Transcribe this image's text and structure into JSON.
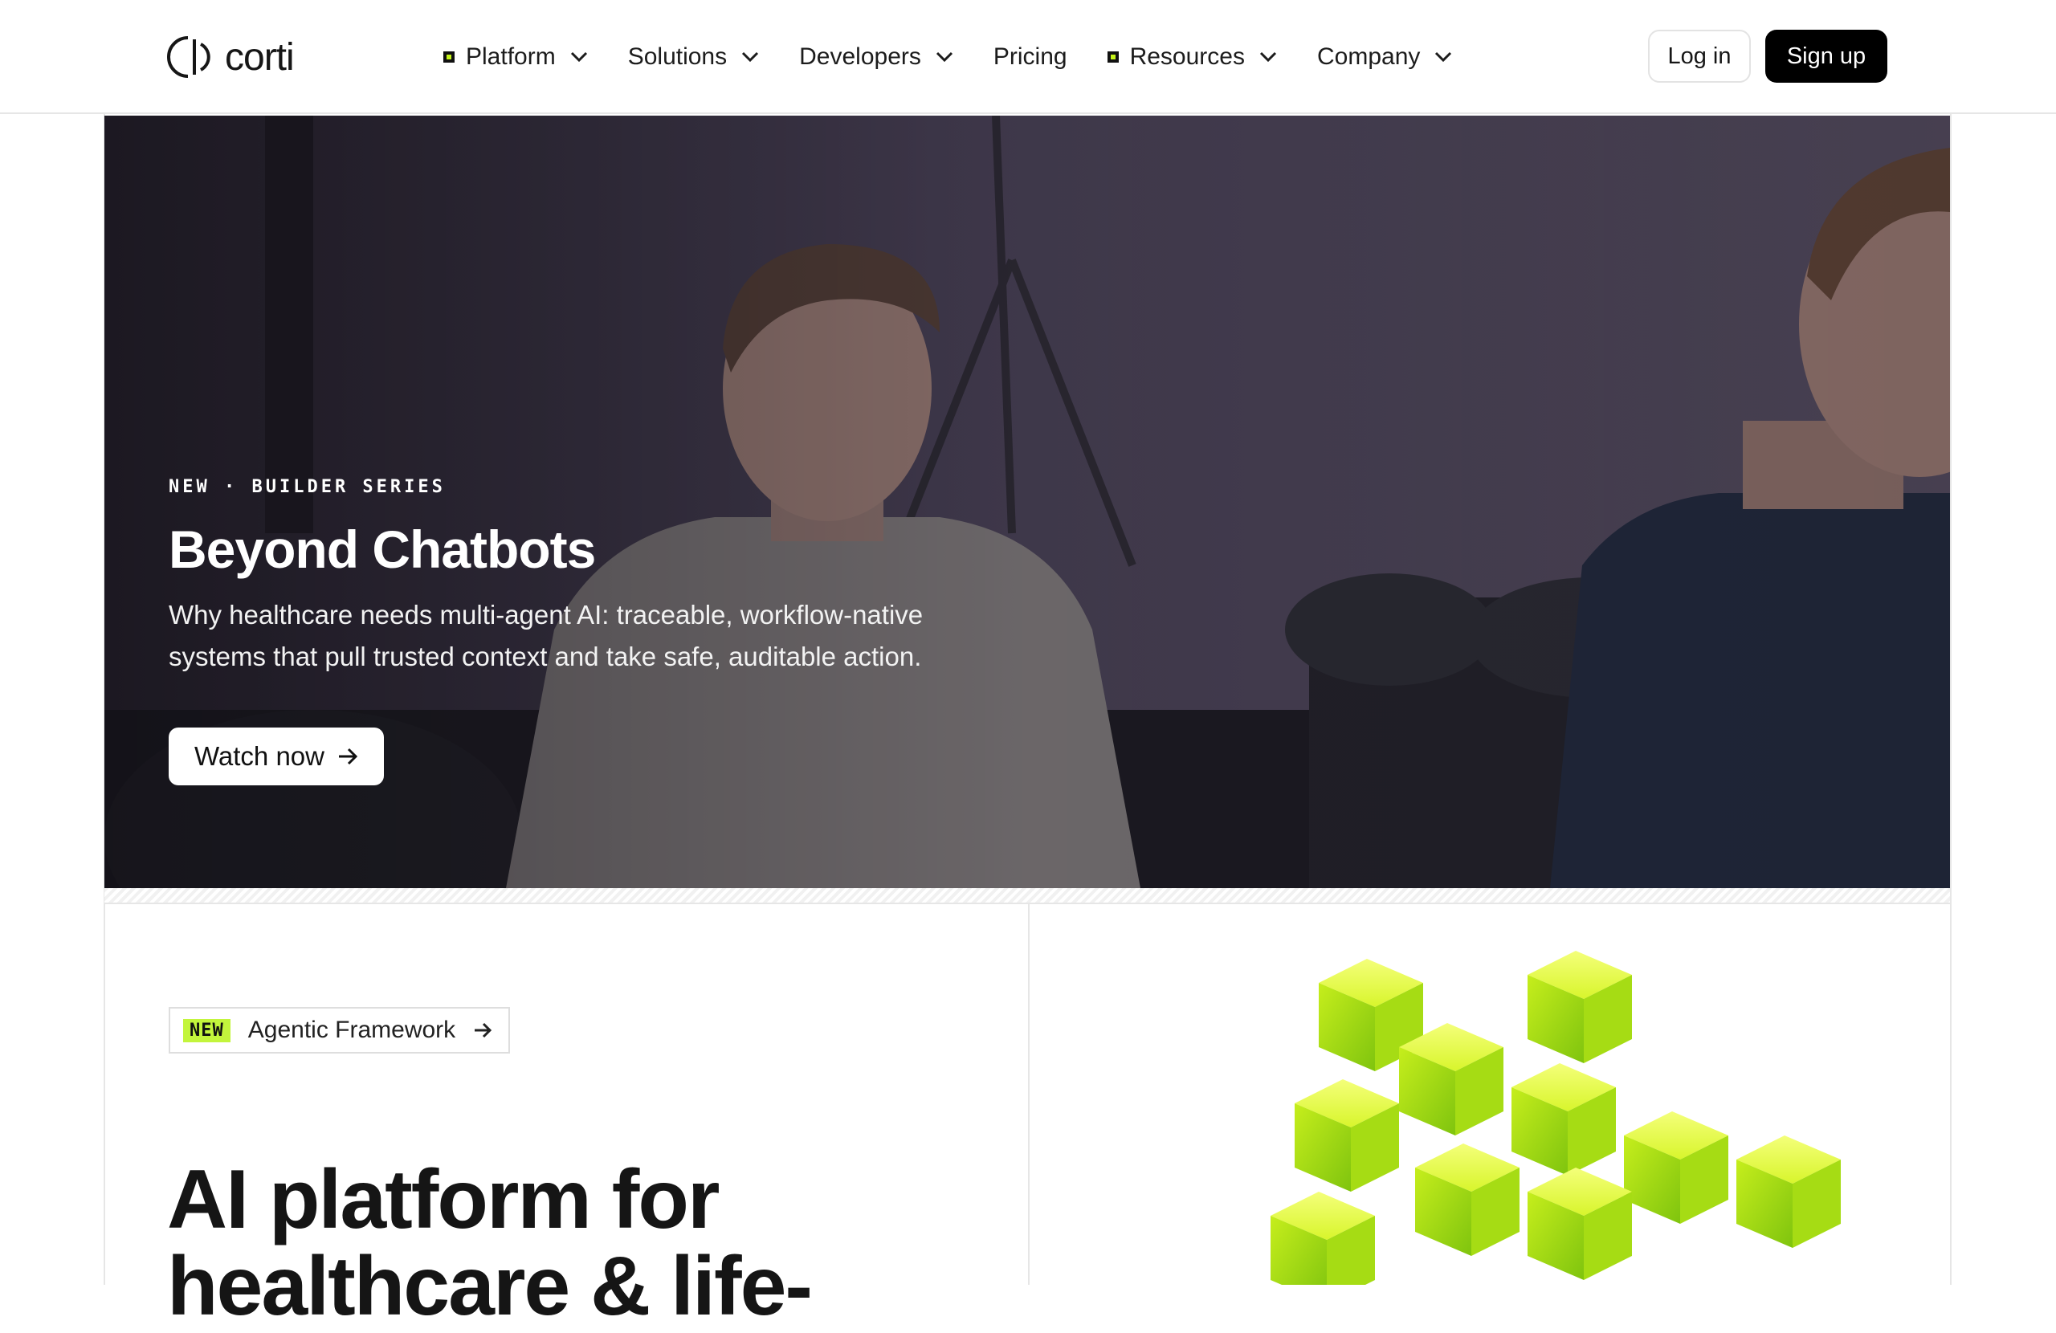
{
  "header": {
    "logo_text": "corti",
    "nav": [
      {
        "label": "Platform",
        "marker": true,
        "dropdown": true
      },
      {
        "label": "Solutions",
        "marker": false,
        "dropdown": true
      },
      {
        "label": "Developers",
        "marker": false,
        "dropdown": true
      },
      {
        "label": "Pricing",
        "marker": false,
        "dropdown": false
      },
      {
        "label": "Resources",
        "marker": true,
        "dropdown": true
      },
      {
        "label": "Company",
        "marker": false,
        "dropdown": true
      }
    ],
    "login_label": "Log in",
    "signup_label": "Sign up"
  },
  "hero": {
    "eyebrow": "NEW · BUILDER SERIES",
    "title": "Beyond Chatbots",
    "description": "Why healthcare needs multi-agent AI: traceable, workflow-native systems that pull trusted context and take safe, auditable action.",
    "cta_label": "Watch now"
  },
  "feature": {
    "badge": "NEW",
    "badge_link": "Agentic Framework",
    "heading": "AI platform for healthcare & life-"
  },
  "colors": {
    "accent": "#c3f53c",
    "primary": "#000000",
    "hero_overlay": "#3f3a45"
  },
  "icons": [
    "corti-logo-icon",
    "chevron-down-icon",
    "arrow-right-icon"
  ]
}
